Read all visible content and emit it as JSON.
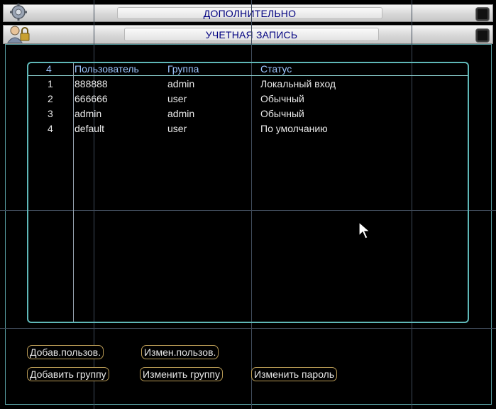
{
  "title_main": "ДОПОЛНИТЕЛЬНО",
  "title_sub": "УЧЕТНАЯ ЗАПИСЬ",
  "table": {
    "headers": {
      "num": "4",
      "user": "Пользователь",
      "group": "Группа",
      "status": "Статус"
    },
    "rows": [
      {
        "num": "1",
        "user": "888888",
        "group": "admin",
        "status": "Локальный вход"
      },
      {
        "num": "2",
        "user": "666666",
        "group": "user",
        "status": "Обычный"
      },
      {
        "num": "3",
        "user": "admin",
        "group": "admin",
        "status": "Обычный"
      },
      {
        "num": "4",
        "user": "default",
        "group": "user",
        "status": "По умолчанию"
      }
    ]
  },
  "buttons": {
    "add_user": "Добав.пользов.",
    "edit_user": "Измен.пользов.",
    "add_group": "Добавить группу",
    "edit_group": "Изменить группу",
    "change_password": "Изменить пароль"
  },
  "icons": {
    "title1": "settings-gear-icon",
    "title2": "users-lock-icon",
    "close": "close-icon",
    "cursor": "mouse-cursor-icon"
  },
  "colors": {
    "title_text": "#000080",
    "table_border": "#5fb8b8",
    "header_text": "#9ec6ff",
    "button_border": "#b89a55"
  }
}
